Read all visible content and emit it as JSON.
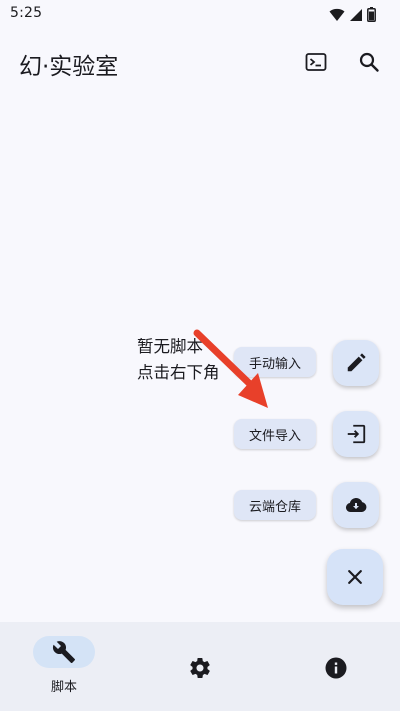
{
  "status_bar": {
    "time": "5:25",
    "icons": [
      "wifi-icon",
      "signal-icon",
      "battery-icon"
    ]
  },
  "app_bar": {
    "title": "幻·实验室",
    "actions": [
      "terminal-icon",
      "search-icon"
    ]
  },
  "empty_state": {
    "line1": "暂无脚本",
    "line2": "点击右下角"
  },
  "fab_menu": {
    "items": [
      {
        "label": "手动输入",
        "icon": "pencil-icon"
      },
      {
        "label": "文件导入",
        "icon": "import-icon"
      },
      {
        "label": "云端仓库",
        "icon": "cloud-download-icon"
      }
    ],
    "close_icon": "close-icon"
  },
  "bottom_nav": {
    "items": [
      {
        "label": "脚本",
        "icon": "wrench-icon",
        "selected": true
      },
      {
        "label": "",
        "icon": "gear-icon",
        "selected": false
      },
      {
        "label": "",
        "icon": "info-icon",
        "selected": false
      }
    ]
  },
  "colors": {
    "background": "#f8f8fd",
    "fab": "#dbe5f7",
    "chip": "#dfe6f6",
    "nav_bar": "#eceef5",
    "nav_selected": "#d4e3f6",
    "arrow": "#e8402a"
  }
}
